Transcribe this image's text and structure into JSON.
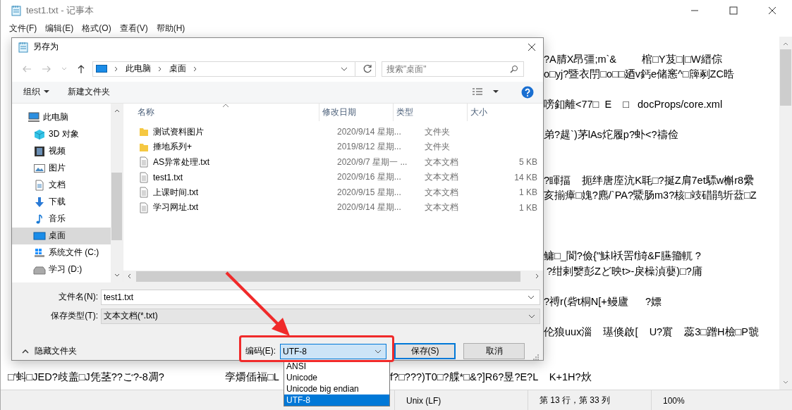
{
  "notepad": {
    "title": "test1.txt - 记事本",
    "menu": [
      "文件(F)",
      "编辑(E)",
      "格式(O)",
      "查看(V)",
      "帮助(H)"
    ],
    "lines": [
      {
        "kind": "blank"
      },
      {
        "kind": "right",
        "text": "?A腈X昂彊;m`&         棺□Y芨□|□W縉倧"
      },
      {
        "kind": "right",
        "text": "o□yj?暨衣閅□o□□廼v鈣e储窸^□簰剢ZC晧"
      },
      {
        "kind": "blank"
      },
      {
        "kind": "right",
        "text": "嗙釦離<77□  E    □   docProps/core.xml"
      },
      {
        "kind": "blank"
      },
      {
        "kind": "right",
        "text": "弟?趧`)茅lAs炨履p?虲<?禱俭"
      },
      {
        "kind": "blank"
      },
      {
        "kind": "blank"
      },
      {
        "kind": "right",
        "text": "?睴揊    扼绊唐庢沆K毦□?挻Z肩7et驃w槲r8纍"
      },
      {
        "kind": "right",
        "text": "亥揃瘴□媿?麃/`PA?鱀肠m3?核□攱碏鹃圻葐□Z"
      },
      {
        "kind": "blank"
      },
      {
        "kind": "blank"
      },
      {
        "kind": "blank"
      },
      {
        "kind": "right",
        "text": "鳙□_閬?儉{\"鮇l祅罟f旑&F臙籀軏 ?"
      },
      {
        "kind": "right",
        "text": " ?绀剌嫛彭Zど映t>-戾橾湞蘡)□?庯"
      },
      {
        "kind": "blank"
      },
      {
        "kind": "right",
        "text": "?禣r(砦t桐N[+鳗廬      ?嫖"
      },
      {
        "kind": "blank"
      },
      {
        "kind": "right",
        "text": "伦狼uux淄    璂倏啟[    U?賔    蕊3□蹭H檢□P虢"
      },
      {
        "kind": "blank"
      },
      {
        "kind": "blank"
      },
      {
        "kind": "split",
        "segments": [
          "□'蚪□JED?歧盖□J凭茎??ご?-8凋?",
          "孪爝偛福□L",
          "f?□???)T0□?艓*□&?]R6?昱?E?L    K+1H?炏"
        ]
      }
    ],
    "status_bar": {
      "line_ending": "Unix (LF)",
      "position": "第 13 行，第 33 列",
      "zoom": "100%"
    }
  },
  "dialog": {
    "title": "另存为",
    "breadcrumb": [
      "此电脑",
      "桌面"
    ],
    "search": {
      "placeholder": "搜索\"桌面\""
    },
    "toolbar": {
      "organize": "组织",
      "new_folder": "新建文件夹"
    },
    "nav_tree": [
      {
        "label": "此电脑",
        "kind": "pc",
        "selected": false,
        "children": [
          {
            "label": "3D 对象",
            "kind": "cube",
            "selected": false
          },
          {
            "label": "视频",
            "kind": "video",
            "selected": false
          },
          {
            "label": "图片",
            "kind": "pictures",
            "selected": false
          },
          {
            "label": "文档",
            "kind": "documents",
            "selected": false
          },
          {
            "label": "下载",
            "kind": "downloads",
            "selected": false
          },
          {
            "label": "音乐",
            "kind": "music",
            "selected": false
          },
          {
            "label": "桌面",
            "kind": "desktop",
            "selected": true
          },
          {
            "label": "系统文件 (C:)",
            "kind": "system-drive",
            "selected": false
          },
          {
            "label": "学习 (D:)",
            "kind": "drive",
            "selected": false
          }
        ]
      }
    ],
    "columns": [
      "名称",
      "修改日期",
      "类型",
      "大小"
    ],
    "files": [
      {
        "kind": "folder",
        "name": "测试资料图片",
        "date": "2020/9/14 星期...",
        "type": "文件夹"
      },
      {
        "kind": "folder",
        "name": "捶地系列+",
        "date": "2019/8/12 星期...",
        "type": "文件夹"
      },
      {
        "kind": "text",
        "name": "AS异常处理.txt",
        "date": "2020/9/7 星期一 ...",
        "type": "文本文档",
        "size": "5 KB"
      },
      {
        "kind": "text",
        "name": "test1.txt",
        "date": "2020/9/16 星期...",
        "type": "文本文档",
        "size": "14 KB"
      },
      {
        "kind": "text",
        "name": "上课时间.txt",
        "date": "2020/9/15 星期...",
        "type": "文本文档",
        "size": "1 KB"
      },
      {
        "kind": "text",
        "name": "学习网址.txt",
        "date": "2020/9/14 星期...",
        "type": "文本文档",
        "size": "1 KB"
      }
    ],
    "file_name": {
      "label": "文件名(N):",
      "value": "test1.txt"
    },
    "save_type": {
      "label": "保存类型(T):",
      "value": "文本文档(*.txt)"
    },
    "hide_folders": "隐藏文件夹",
    "encoding": {
      "label": "编码(E):",
      "value": "UTF-8",
      "expanded": true,
      "options": [
        {
          "label": "ANSI",
          "selected": false
        },
        {
          "label": "Unicode",
          "selected": false
        },
        {
          "label": "Unicode big endian",
          "selected": false
        },
        {
          "label": "UTF-8",
          "selected": true
        }
      ]
    },
    "buttons": [
      {
        "label": "保存(S)",
        "default": true
      },
      {
        "label": "取消",
        "default": false
      }
    ]
  }
}
